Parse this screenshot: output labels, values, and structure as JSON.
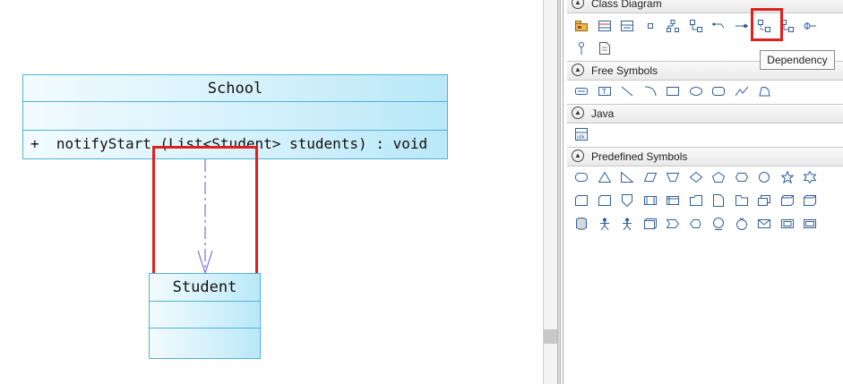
{
  "diagram": {
    "school": {
      "name": "School",
      "operation": "+  notifyStart (List<Student> students) : void"
    },
    "student": {
      "name": "Student"
    },
    "relation": "dependency"
  },
  "palette": {
    "sections": [
      {
        "label": "Class Diagram"
      },
      {
        "label": "Free Symbols"
      },
      {
        "label": "Java"
      },
      {
        "label": "Predefined Symbols"
      }
    ],
    "tooltip": "Dependency",
    "highlight_color": "#e0201d",
    "class_box_color": "#b9e8f8"
  }
}
